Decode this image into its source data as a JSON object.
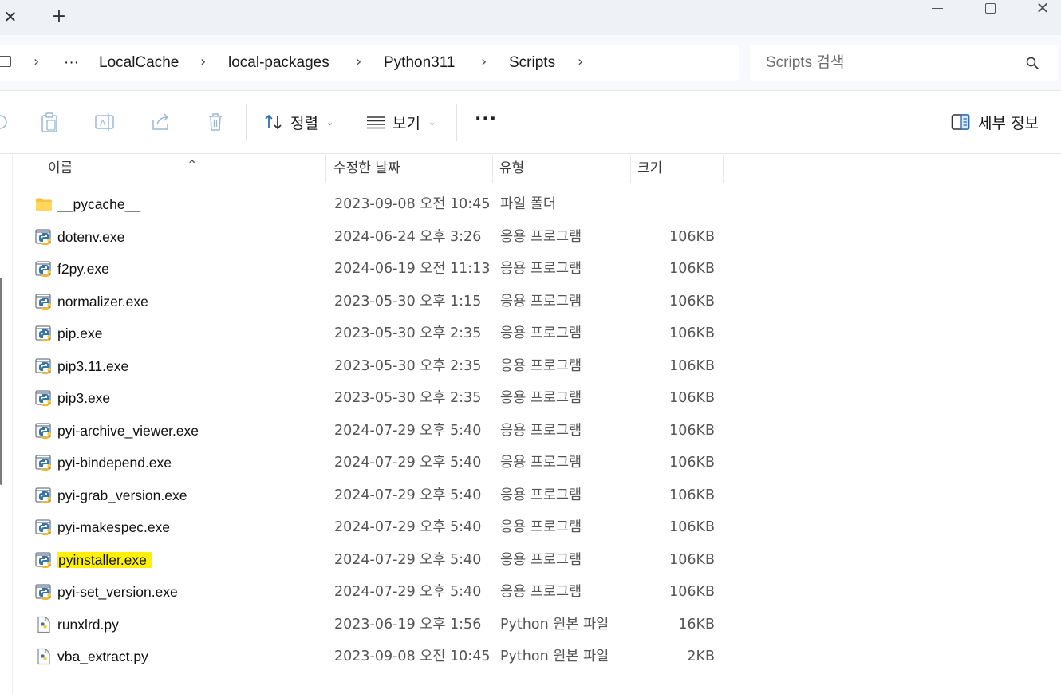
{
  "titlebar": {
    "close_tab_glyph": "✕",
    "new_tab_glyph": "+"
  },
  "address": {
    "overflow": "···",
    "crumbs": [
      "LocalCache",
      "local-packages",
      "Python311",
      "Scripts"
    ]
  },
  "search": {
    "placeholder": "Scripts 검색"
  },
  "toolbar": {
    "sort_label": "정렬",
    "view_label": "보기",
    "more_label": "···",
    "details_label": "세부 정보"
  },
  "columns": {
    "name": "이름",
    "modified": "수정한 날짜",
    "type": "유형",
    "size": "크기"
  },
  "files": [
    {
      "name": "__pycache__",
      "modified": "2023-09-08 오전 10:45",
      "type": "파일 폴더",
      "size": "",
      "icon": "folder-icon"
    },
    {
      "name": "dotenv.exe",
      "modified": "2024-06-24 오후 3:26",
      "type": "응용 프로그램",
      "size": "106KB",
      "icon": "python-exe-icon"
    },
    {
      "name": "f2py.exe",
      "modified": "2024-06-19 오전 11:13",
      "type": "응용 프로그램",
      "size": "106KB",
      "icon": "python-exe-icon"
    },
    {
      "name": "normalizer.exe",
      "modified": "2023-05-30 오후 1:15",
      "type": "응용 프로그램",
      "size": "106KB",
      "icon": "python-exe-icon"
    },
    {
      "name": "pip.exe",
      "modified": "2023-05-30 오후 2:35",
      "type": "응용 프로그램",
      "size": "106KB",
      "icon": "python-exe-icon"
    },
    {
      "name": "pip3.11.exe",
      "modified": "2023-05-30 오후 2:35",
      "type": "응용 프로그램",
      "size": "106KB",
      "icon": "python-exe-icon"
    },
    {
      "name": "pip3.exe",
      "modified": "2023-05-30 오후 2:35",
      "type": "응용 프로그램",
      "size": "106KB",
      "icon": "python-exe-icon"
    },
    {
      "name": "pyi-archive_viewer.exe",
      "modified": "2024-07-29 오후 5:40",
      "type": "응용 프로그램",
      "size": "106KB",
      "icon": "python-exe-icon"
    },
    {
      "name": "pyi-bindepend.exe",
      "modified": "2024-07-29 오후 5:40",
      "type": "응용 프로그램",
      "size": "106KB",
      "icon": "python-exe-icon"
    },
    {
      "name": "pyi-grab_version.exe",
      "modified": "2024-07-29 오후 5:40",
      "type": "응용 프로그램",
      "size": "106KB",
      "icon": "python-exe-icon"
    },
    {
      "name": "pyi-makespec.exe",
      "modified": "2024-07-29 오후 5:40",
      "type": "응용 프로그램",
      "size": "106KB",
      "icon": "python-exe-icon"
    },
    {
      "name": "pyinstaller.exe",
      "modified": "2024-07-29 오후 5:40",
      "type": "응용 프로그램",
      "size": "106KB",
      "icon": "python-exe-icon",
      "highlight": "#fff200"
    },
    {
      "name": "pyi-set_version.exe",
      "modified": "2024-07-29 오후 5:40",
      "type": "응용 프로그램",
      "size": "106KB",
      "icon": "python-exe-icon"
    },
    {
      "name": "runxlrd.py",
      "modified": "2023-06-19 오후 1:56",
      "type": "Python 원본 파일",
      "size": "16KB",
      "icon": "python-file-icon"
    },
    {
      "name": "vba_extract.py",
      "modified": "2023-09-08 오전 10:45",
      "type": "Python 원본 파일",
      "size": "2KB",
      "icon": "python-file-icon"
    }
  ],
  "colors": {
    "titlebar_bg": "#eef1f5",
    "address_bg": "#f7f9fc",
    "highlight": "#fff200",
    "folder": "#f5c242",
    "python_blue": "#3773a5",
    "python_yellow": "#f7c93c"
  }
}
